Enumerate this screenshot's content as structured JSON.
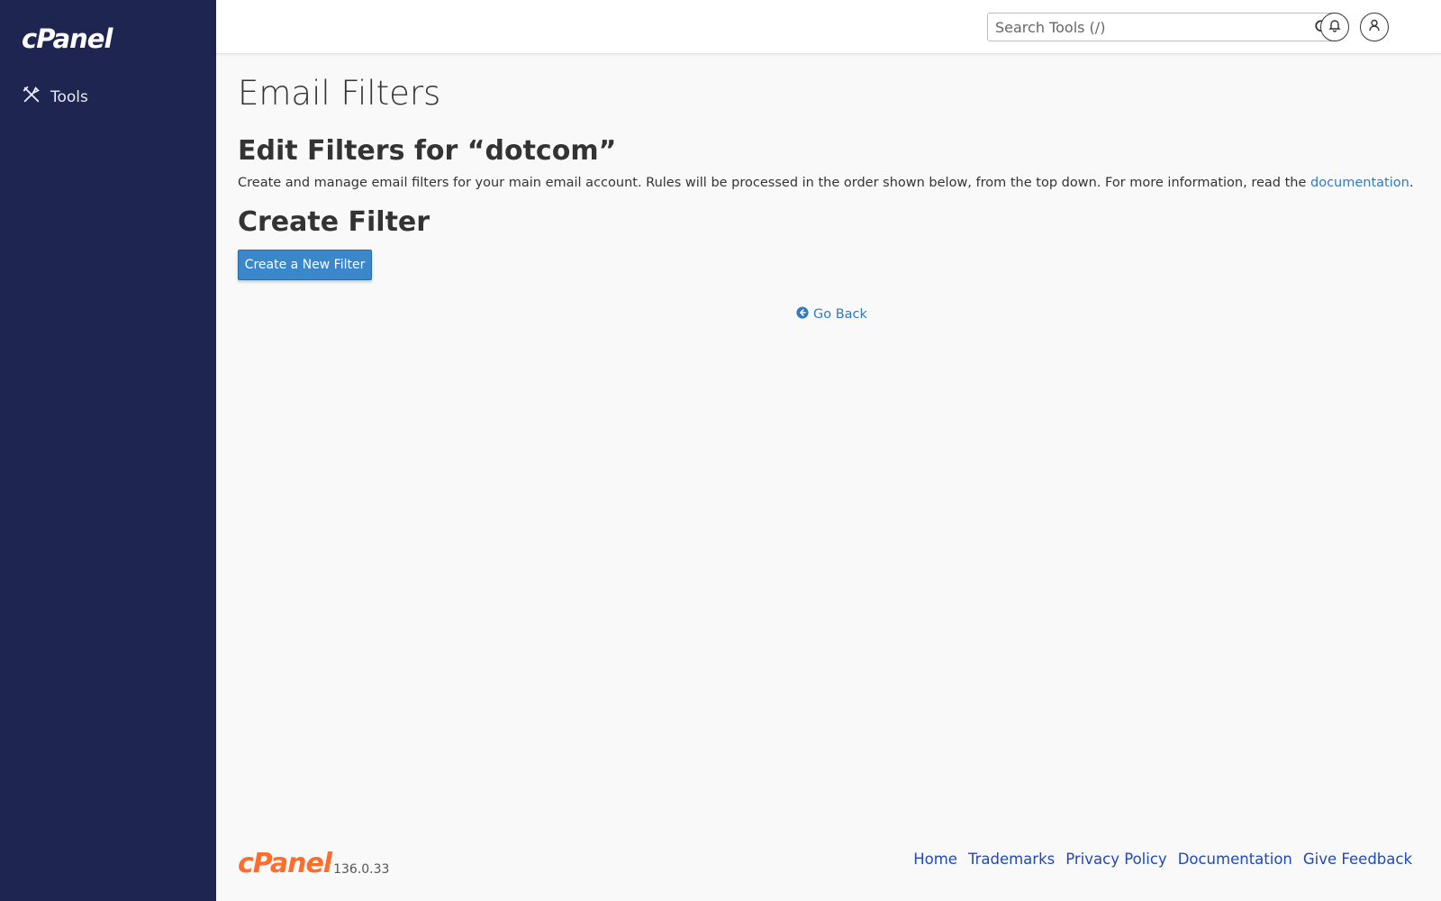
{
  "brand": {
    "name": "cPanel"
  },
  "sidebar": {
    "items": [
      {
        "label": "Tools",
        "icon": "tools-icon"
      }
    ]
  },
  "topbar": {
    "search": {
      "placeholder": "Search Tools (/)",
      "value": ""
    },
    "icons": [
      "search-icon",
      "bell-icon",
      "user-icon"
    ]
  },
  "main": {
    "page_title": "Email Filters",
    "edit_heading": "Edit Filters for “dotcom”",
    "description": {
      "text": "Create and manage email filters for your main email account. Rules will be processed in the order shown below, from the top down. For more information, read the ",
      "link_text": "documentation",
      "suffix": "."
    },
    "create_heading": "Create Filter",
    "create_button": "Create a New Filter",
    "go_back": "Go Back"
  },
  "footer": {
    "logo": "cPanel",
    "version": "136.0.33",
    "links": [
      "Home",
      "Trademarks",
      "Privacy Policy",
      "Documentation",
      "Give Feedback"
    ]
  },
  "colors": {
    "sidebar_bg": "#1f2551",
    "primary_button": "#3a87cc",
    "link": "#2f7bbf",
    "footer_link": "#1f49b6",
    "footer_logo": "#ff6c2c"
  }
}
